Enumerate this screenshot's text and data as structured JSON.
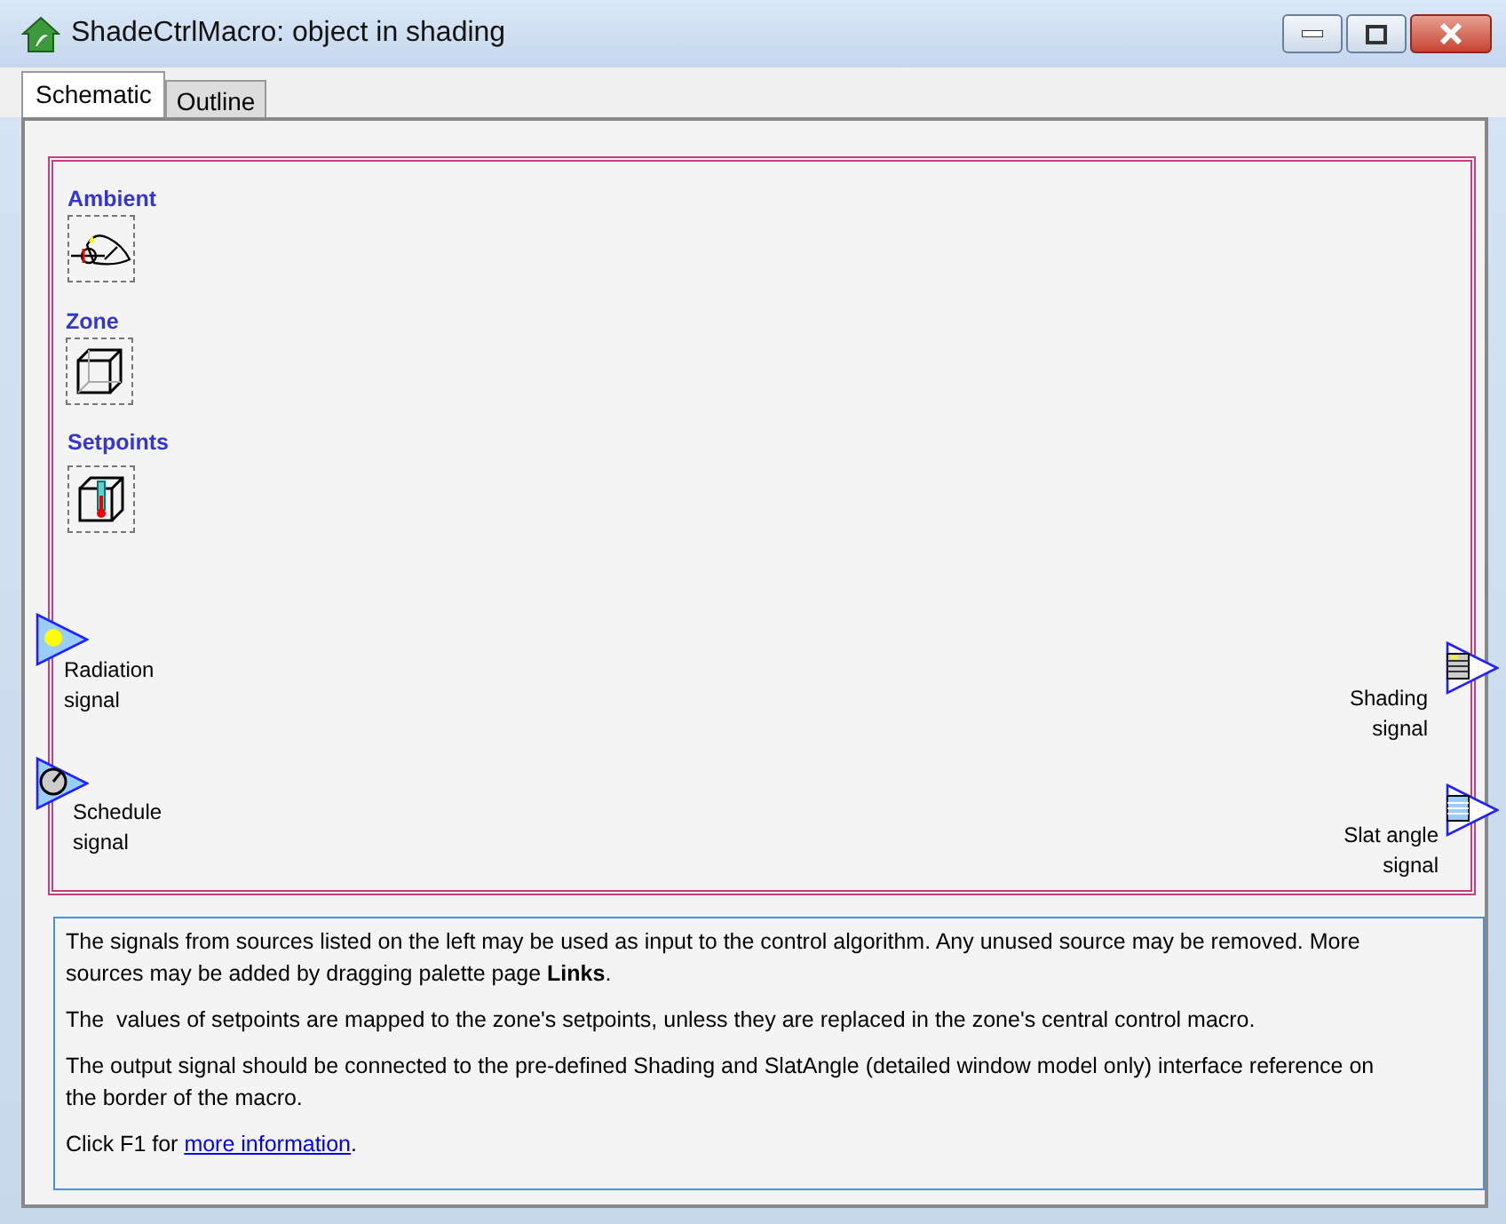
{
  "window": {
    "title": "ShadeCtrlMacro: object in shading"
  },
  "tabs": [
    {
      "label": "Schematic",
      "selected": true
    },
    {
      "label": "Outline",
      "selected": false
    }
  ],
  "sources": [
    {
      "label": "Ambient",
      "kind": "ambient"
    },
    {
      "label": "Zone",
      "kind": "zone"
    },
    {
      "label": "Setpoints",
      "kind": "setpoints"
    }
  ],
  "inputs": [
    {
      "label": "Radiation signal",
      "kind": "radiation"
    },
    {
      "label": "Schedule signal",
      "kind": "schedule"
    }
  ],
  "outputs": [
    {
      "label": "Shading signal",
      "kind": "shading"
    },
    {
      "label": "Slat angle signal",
      "kind": "slat"
    }
  ],
  "info": [
    {
      "text": "The signals from sources listed on the left may be used as input to the control algorithm. Any unused source may be removed. More sources may be added by dragging palette page **Links**."
    },
    {
      "text": "The  values of setpoints are mapped to the zone's setpoints, unless they are replaced in the zone's central control macro."
    },
    {
      "text": "The output signal should be connected to the pre-defined Shading and SlatAngle (detailed window model only) interface reference on the border of the macro."
    },
    {
      "text": "Click F1 for ",
      "link": "more information",
      "tail": "."
    }
  ]
}
